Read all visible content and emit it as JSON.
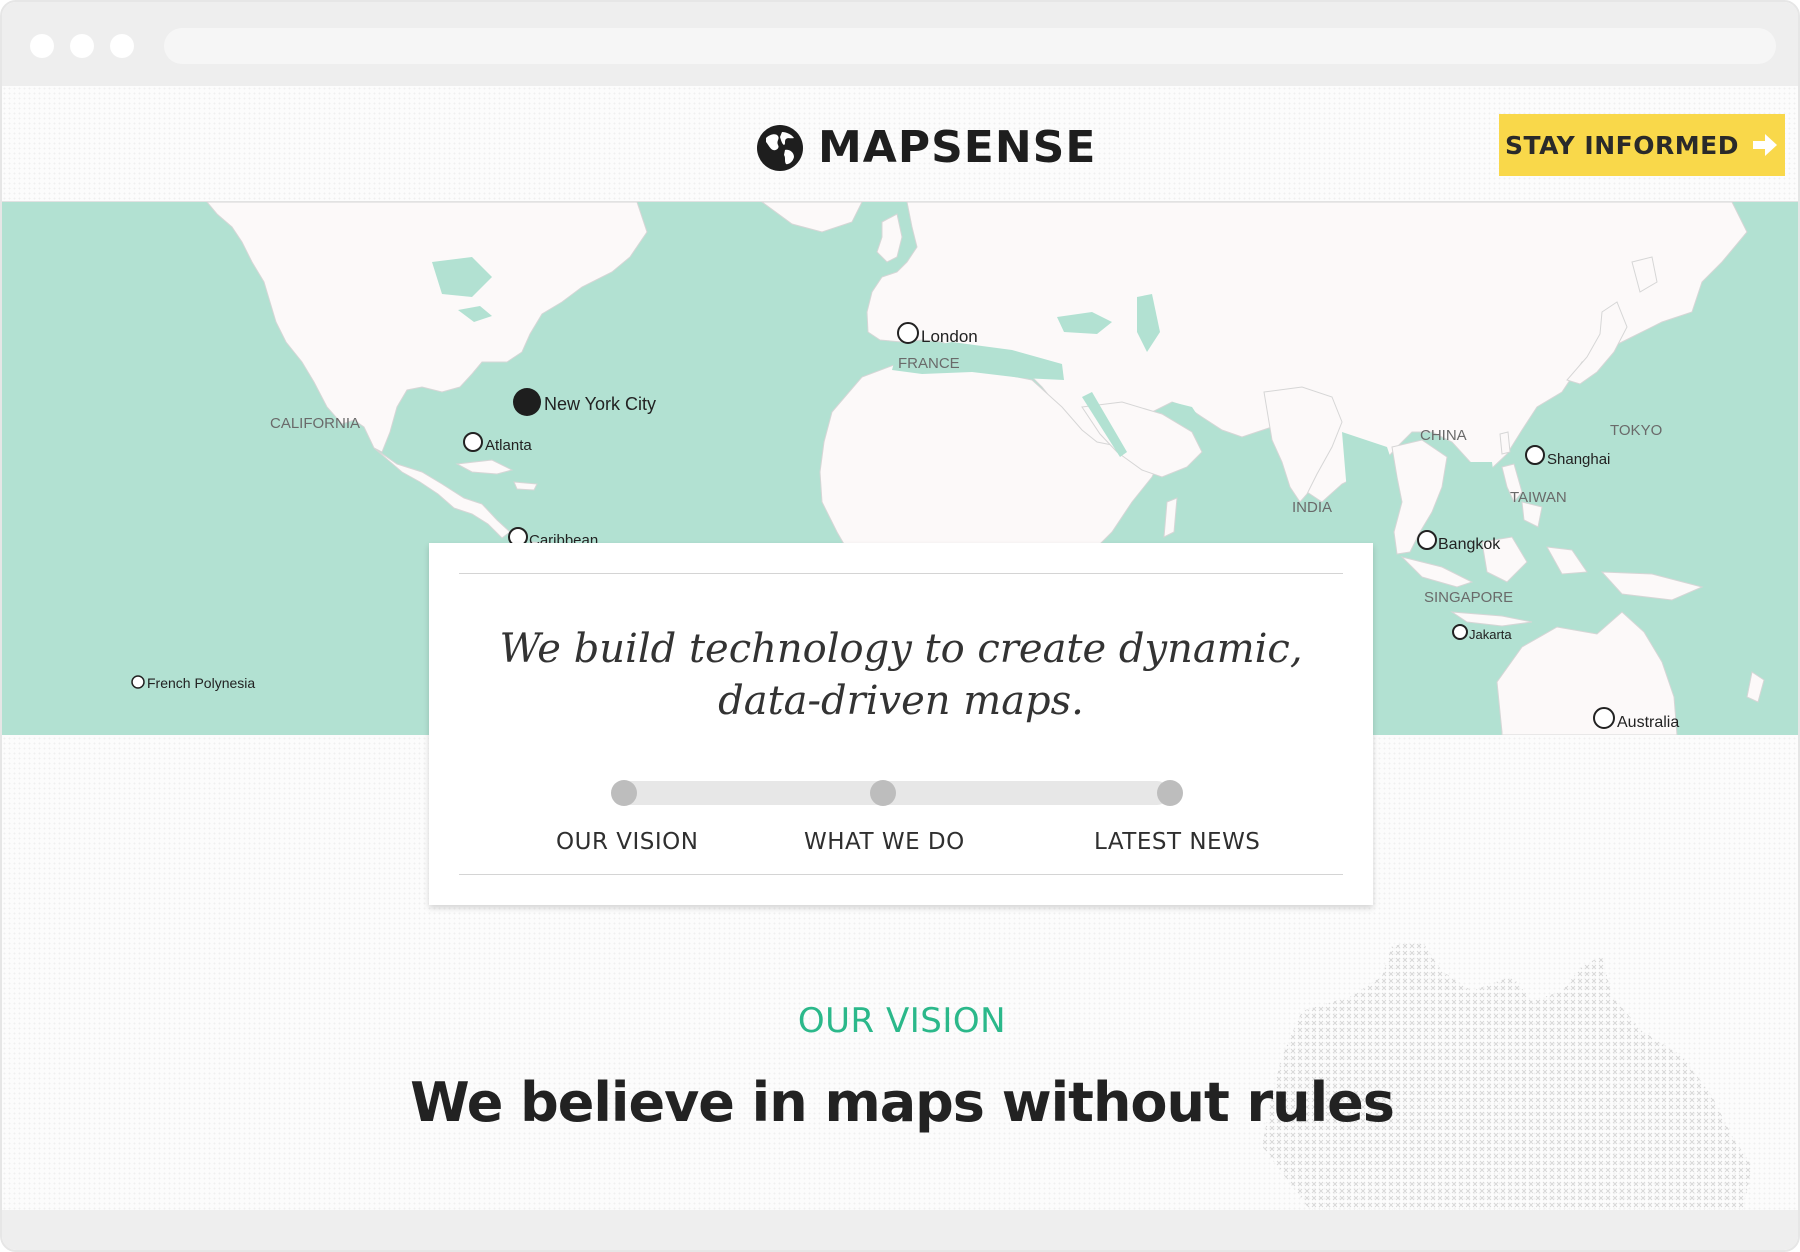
{
  "brand": {
    "name": "MAPSENSE",
    "logo_icon": "globe-icon"
  },
  "header": {
    "cta_label": "STAY INFORMED",
    "cta_icon": "arrow-right-icon",
    "cta_color": "#f9d84a"
  },
  "map": {
    "water_color": "#b2e1d2",
    "land_color": "#fcf9f9",
    "cities": [
      {
        "label": "London",
        "marker": "open-circle"
      },
      {
        "label": "New York City",
        "marker": "filled-circle"
      },
      {
        "label": "Atlanta",
        "marker": "open-circle"
      },
      {
        "label": "Caribbean",
        "marker": "open-circle"
      },
      {
        "label": "French Polynesia",
        "marker": "open-circle"
      },
      {
        "label": "Shanghai",
        "marker": "open-circle"
      },
      {
        "label": "Bangkok",
        "marker": "open-circle"
      },
      {
        "label": "Jakarta",
        "marker": "open-circle"
      },
      {
        "label": "Australia",
        "marker": "open-circle"
      }
    ],
    "regions": [
      "CALIFORNIA",
      "FRANCE",
      "CHINA",
      "TOKYO",
      "TAIWAN",
      "INDIA",
      "SINGAPORE"
    ]
  },
  "hero": {
    "tagline_line1": "We build technology to create dynamic,",
    "tagline_line2": "data-driven maps.",
    "nav": [
      "OUR VISION",
      "WHAT WE DO",
      "LATEST NEWS"
    ]
  },
  "vision": {
    "heading": "OUR VISION",
    "heading_color": "#2bb88a",
    "title": "We believe in maps without rules"
  }
}
